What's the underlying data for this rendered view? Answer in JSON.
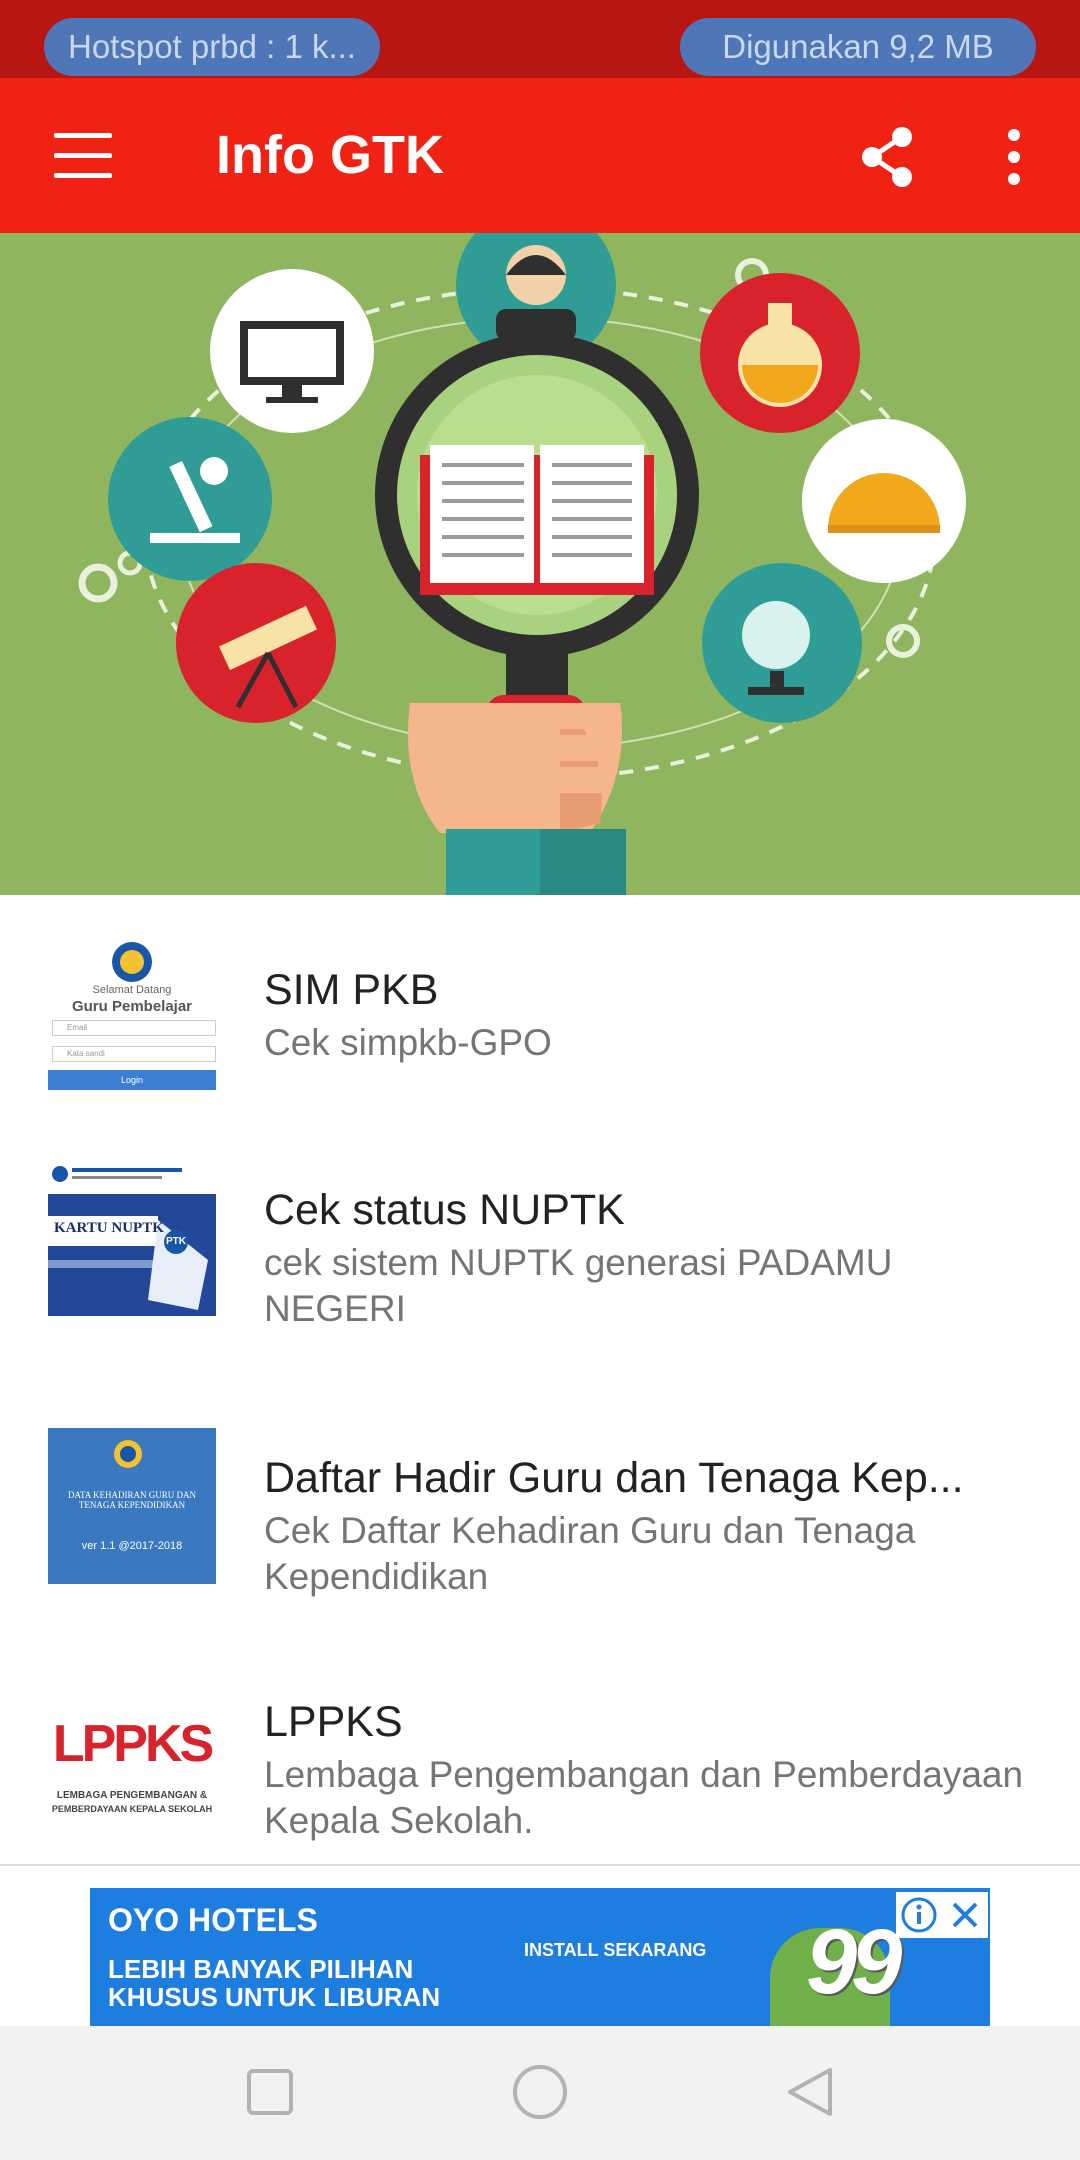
{
  "status_bar": {
    "hotspot_text": "Hotspot prbd : 1 k...",
    "data_usage": "Digunakan 9,2 MB"
  },
  "app_bar": {
    "title": "Info GTK",
    "menu_icon": "hamburger-menu-icon",
    "share_icon": "share-icon",
    "more_icon": "more-vert-icon",
    "color": "#f02214"
  },
  "list": {
    "items": [
      {
        "title": "SIM PKB",
        "description": "Cek simpkb-GPO",
        "thumb": {
          "line1": "Selamat Datang",
          "line2": "Guru Pembelajar",
          "field1": "Email",
          "field2": "Kata sandi",
          "button": "Login"
        }
      },
      {
        "title": "Cek status NUPTK",
        "description": "cek sistem NUPTK generasi PADAMU NEGERI",
        "thumb": {
          "heading": "KARTU NUPTK",
          "badge": "PTK"
        }
      },
      {
        "title": "Daftar Hadir Guru dan Tenaga Kep...",
        "description": "Cek Daftar Kehadiran Guru dan Tenaga Kependidikan",
        "thumb": {
          "text": "DATA KEHADIRAN GURU DAN TENAGA KEPENDIDIKAN",
          "version": "ver 1.1 @2017-2018"
        }
      },
      {
        "title": "LPPKS",
        "description": "Lembaga Pengembangan dan Pemberdayaan Kepala Sekolah.",
        "thumb": {
          "logo": "LPPKS",
          "caption1": "LEMBAGA PENGEMBANGAN &",
          "caption2": "PEMBERDAYAAN KEPALA SEKOLAH"
        }
      }
    ]
  },
  "ad": {
    "brand": "OYO HOTELS",
    "line1": "LEBIH BANYAK PILIHAN",
    "line2": "KHUSUS UNTUK LIBURAN",
    "cta": "INSTALL SEKARANG",
    "price": "99",
    "info_icon": "info-icon",
    "close_icon": "close-icon"
  },
  "nav_bar": {
    "recents_icon": "square-recents-icon",
    "home_icon": "circle-home-icon",
    "back_icon": "triangle-back-icon"
  }
}
